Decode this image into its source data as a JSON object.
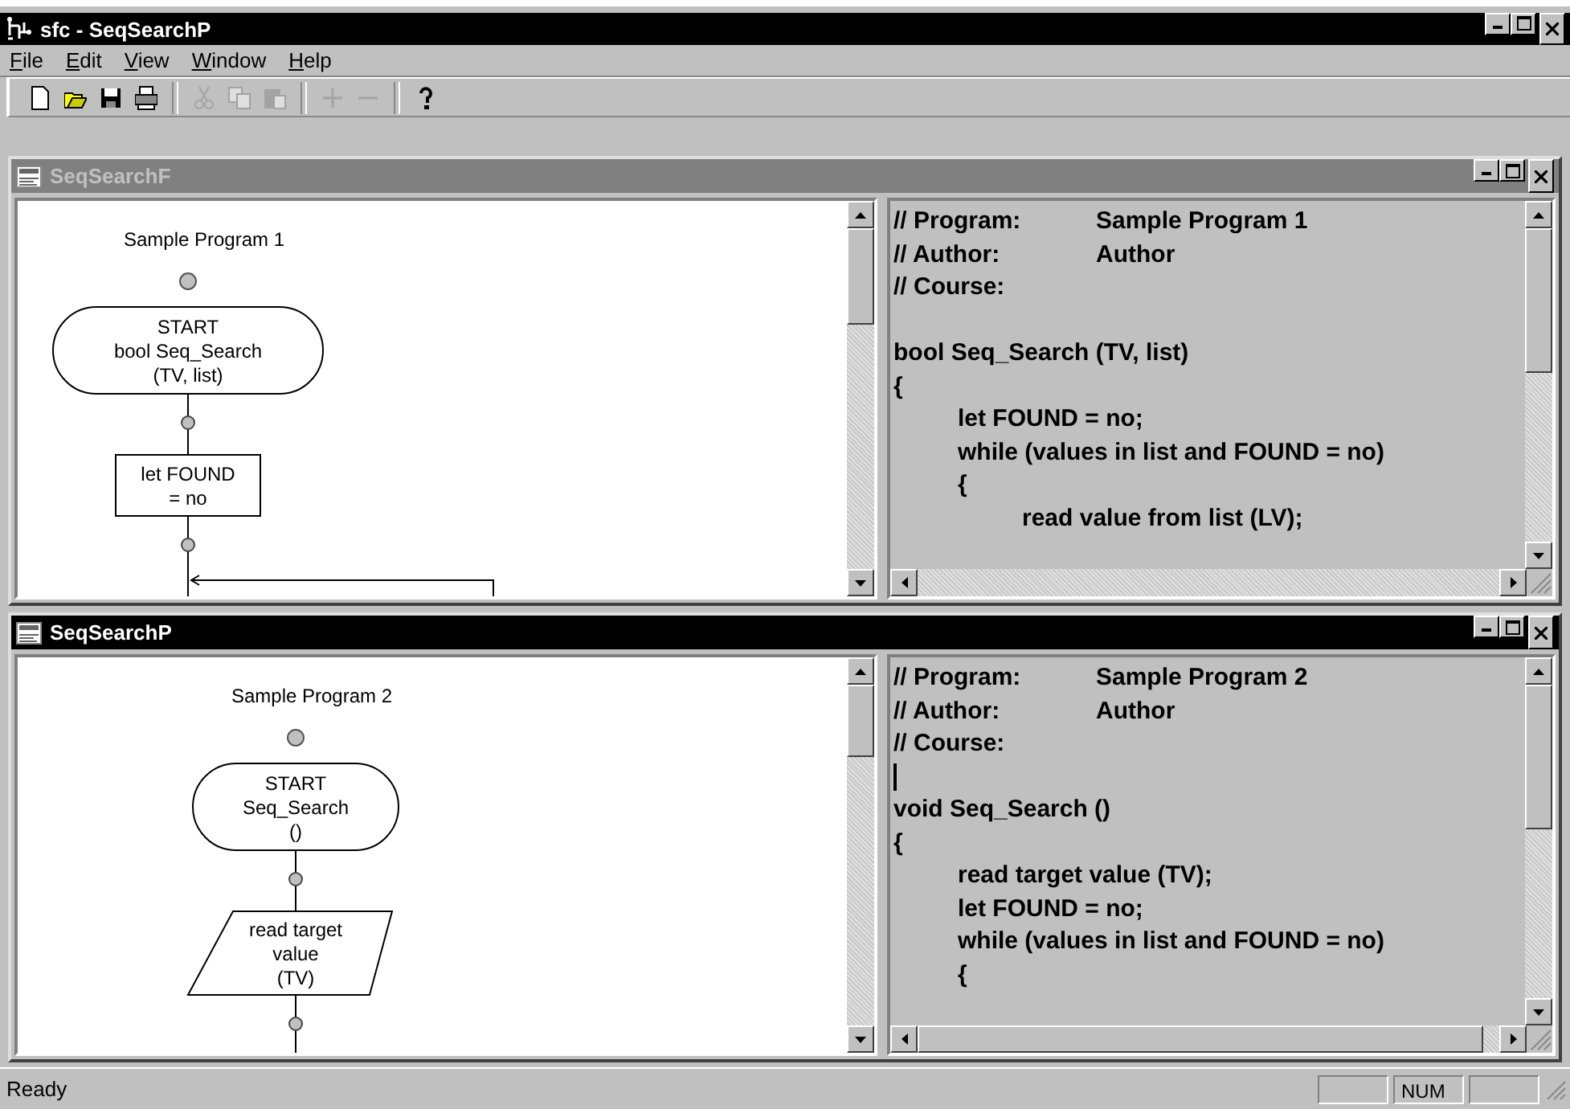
{
  "window": {
    "title": "sfc - SeqSearchP"
  },
  "menu": [
    {
      "label": "File"
    },
    {
      "label": "Edit"
    },
    {
      "label": "View"
    },
    {
      "label": "Window"
    },
    {
      "label": "Help"
    }
  ],
  "toolbar": [
    {
      "kind": "new",
      "disabled": false
    },
    {
      "kind": "open",
      "disabled": false
    },
    {
      "kind": "save",
      "disabled": false
    },
    {
      "kind": "print",
      "disabled": false
    },
    {
      "kind": "separator"
    },
    {
      "kind": "cut",
      "disabled": true
    },
    {
      "kind": "copy",
      "disabled": true
    },
    {
      "kind": "paste",
      "disabled": true
    },
    {
      "kind": "separator"
    },
    {
      "kind": "plus",
      "disabled": true
    },
    {
      "kind": "minus",
      "disabled": true
    },
    {
      "kind": "separator"
    },
    {
      "kind": "help",
      "disabled": false
    }
  ],
  "documents": [
    {
      "title": "SeqSearchF",
      "active": false,
      "flowchart": {
        "title": "Sample Program 1",
        "nodes": [
          {
            "kind": "terminal",
            "lines": [
              "START",
              "bool Seq_Search",
              "(TV, list)"
            ]
          },
          {
            "kind": "process",
            "lines": [
              "let FOUND",
              "= no"
            ]
          },
          {
            "kind": "loop_join"
          }
        ]
      },
      "code": [
        {
          "kind": "header",
          "label": "// Program:",
          "value": "Sample Program 1"
        },
        {
          "kind": "header",
          "label": "// Author:",
          "value": "Author"
        },
        {
          "kind": "header",
          "label": "// Course:"
        },
        {
          "kind": "blank"
        },
        {
          "kind": "code",
          "text": "bool Seq_Search (TV, list)"
        },
        {
          "kind": "code",
          "text": "{"
        },
        {
          "kind": "code",
          "text": "\tlet FOUND = no;"
        },
        {
          "kind": "code",
          "text": "\twhile (values in list and FOUND = no)"
        },
        {
          "kind": "code",
          "text": "\t{"
        },
        {
          "kind": "code",
          "text": "\t\tread value from list (LV);"
        }
      ]
    },
    {
      "title": "SeqSearchP",
      "active": true,
      "flowchart": {
        "title": "Sample Program 2",
        "nodes": [
          {
            "kind": "terminal",
            "lines": [
              "START",
              "Seq_Search",
              "()"
            ]
          },
          {
            "kind": "io",
            "lines": [
              "read target",
              "value",
              "(TV)"
            ]
          },
          {
            "kind": "continue"
          }
        ]
      },
      "code": [
        {
          "kind": "header",
          "label": "// Program:",
          "value": "Sample Program 2"
        },
        {
          "kind": "header",
          "label": "// Author:",
          "value": "Author"
        },
        {
          "kind": "header",
          "label": "// Course:"
        },
        {
          "kind": "cursor"
        },
        {
          "kind": "code",
          "text": "void Seq_Search ()"
        },
        {
          "kind": "code",
          "text": "{"
        },
        {
          "kind": "code",
          "text": "\tread target value (TV);"
        },
        {
          "kind": "code",
          "text": "\tlet FOUND = no;"
        },
        {
          "kind": "code",
          "text": "\twhile (values in list and FOUND = no)"
        },
        {
          "kind": "code",
          "text": "\t{"
        }
      ]
    }
  ],
  "status_bar": {
    "text": "Ready",
    "indicator": "NUM"
  }
}
